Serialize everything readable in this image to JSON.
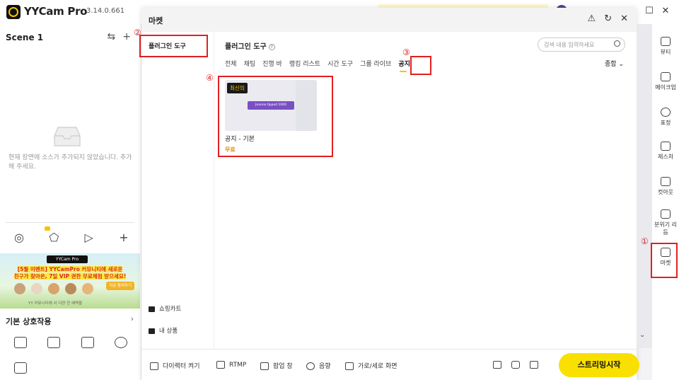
{
  "app": {
    "name": "YYCam Pro",
    "version": "3.14.0.661"
  },
  "window_controls": {
    "restore": "☐",
    "close": "✕"
  },
  "left": {
    "scene_title": "Scene 1",
    "settings_glyph": "⇆",
    "add_glyph": "+",
    "empty_text": "현재 장면에 소스가 추가되지 않았습니다. 추가해 주세요.",
    "source_icons": [
      "record-icon",
      "shapes-icon",
      "video-icon",
      "add-icon"
    ],
    "banner": {
      "logo": "YYCam Pro",
      "line1_a": "[5월 이벤트]",
      "line1_b": " YYCamPro 커뮤니티에 새로운",
      "line2": "친구가 찾아온, 7일 VIP 권한 무료체험 받으세요!",
      "button": "지금 참여하기",
      "footer": "YY 커뮤니티에 서 다양 한 혜택을"
    },
    "basic_title": "기본 상호작용",
    "basic_chev": "›"
  },
  "modal": {
    "title": "마켓",
    "header_icons": [
      "⚠",
      "↻",
      "✕"
    ],
    "side": {
      "plugin_tools": "플러그인 도구",
      "cart": "쇼핑카트",
      "my_products": "내 상품"
    },
    "main": {
      "title": "플러그인 도구",
      "help": "?",
      "search_placeholder": "검색 내용 입력하세요",
      "tabs": [
        "전체",
        "채팅",
        "진행 바",
        "랭킹 리스트",
        "시간 도구",
        "그룹 라이브",
        "공지"
      ],
      "active_tab": "공지",
      "sort": "종합 ⌄",
      "card": {
        "badge": "최신의",
        "pill": "Joanna tipped 1000",
        "name": "공지 - 기본",
        "price": "무료"
      }
    },
    "footer": {
      "director": "다이렉터 켜기",
      "rtmp": "RTMP",
      "popup": "팝업 창",
      "audio": "음향",
      "orientation": "가로/세로 화면",
      "stream": "스트리밍시작"
    },
    "scroll_chev": "⌄"
  },
  "right": {
    "items": [
      "뷰티",
      "메이크업",
      "표정",
      "제스처",
      "컷아웃",
      "분위기 리듬",
      "마켓"
    ]
  },
  "annotations": {
    "n1": "①",
    "n2": "②",
    "n3": "③",
    "n4": "④"
  },
  "colors": {
    "accent": "#f9e000",
    "annotation": "#e02020",
    "price": "#e58c00"
  }
}
